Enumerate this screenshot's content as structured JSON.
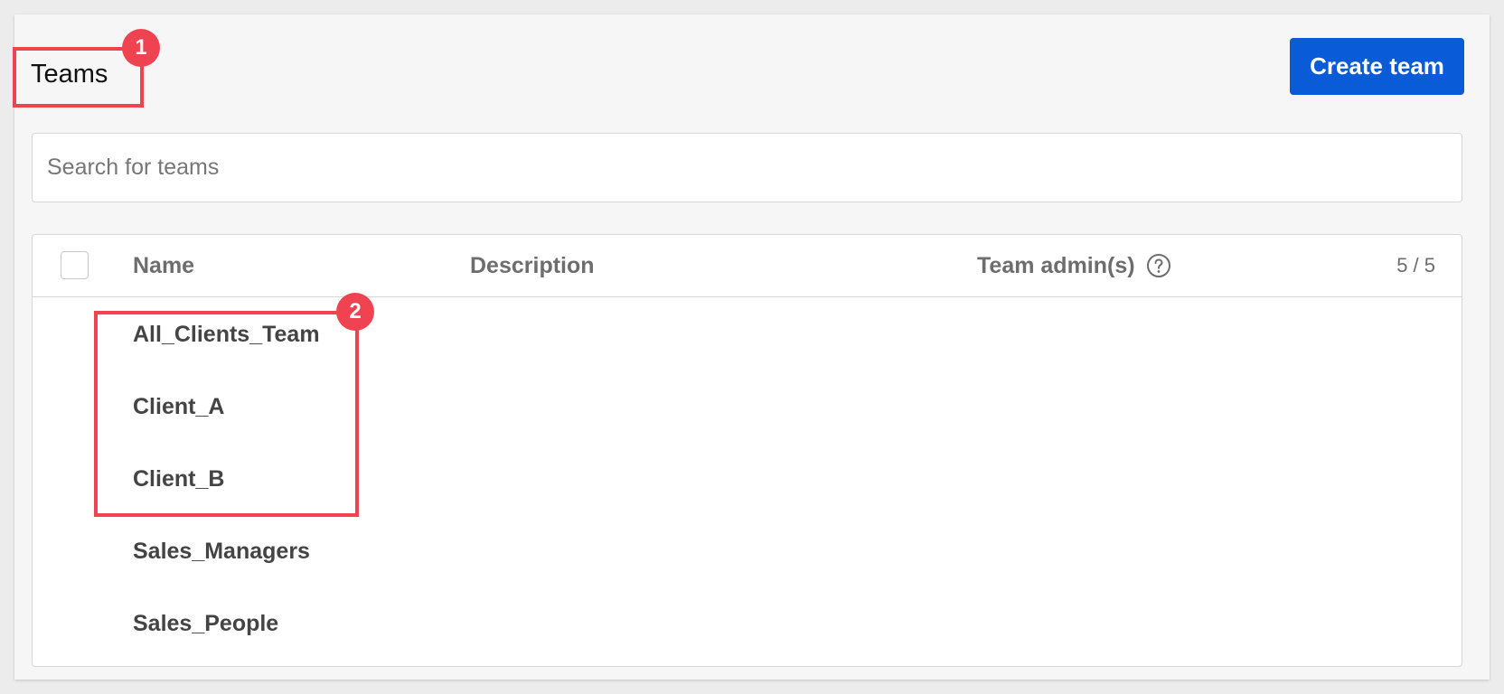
{
  "page": {
    "title": "Teams",
    "create_button": "Create team"
  },
  "search": {
    "placeholder": "Search for teams",
    "value": ""
  },
  "table": {
    "columns": {
      "name": "Name",
      "description": "Description",
      "team_admins": "Team admin(s)"
    },
    "count": "5 / 5",
    "rows": [
      {
        "name": "All_Clients_Team",
        "description": "",
        "team_admins": ""
      },
      {
        "name": "Client_A",
        "description": "",
        "team_admins": ""
      },
      {
        "name": "Client_B",
        "description": "",
        "team_admins": ""
      },
      {
        "name": "Sales_Managers",
        "description": "",
        "team_admins": ""
      },
      {
        "name": "Sales_People",
        "description": "",
        "team_admins": ""
      }
    ]
  },
  "annotations": {
    "marker_1": "1",
    "marker_2": "2"
  },
  "icons": {
    "help": "question-circle-icon"
  },
  "colors": {
    "accent": "#0a5bd8",
    "annotation": "#f04352",
    "background": "#ececec",
    "panel": "#f6f6f6"
  }
}
